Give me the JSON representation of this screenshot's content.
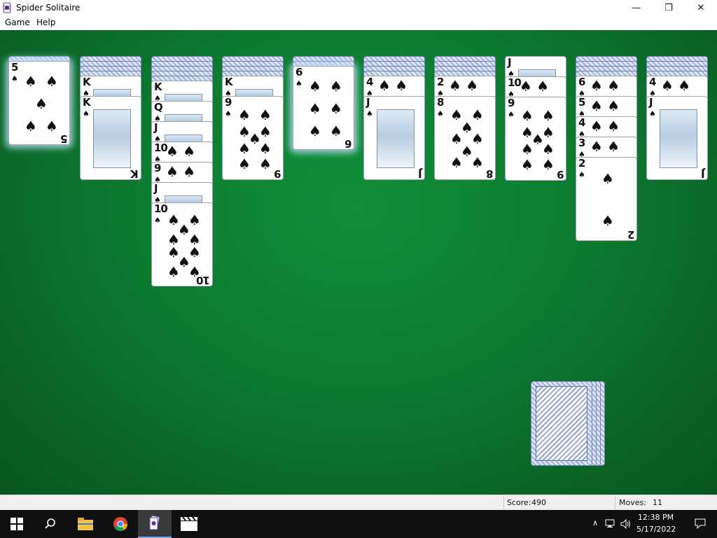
{
  "window": {
    "title": "Spider Solitaire",
    "icon": "spider-solitaire-icon",
    "controls": {
      "minimize": "—",
      "maximize": "❐",
      "close": "✕"
    }
  },
  "menu": [
    {
      "id": "game",
      "label": "Game"
    },
    {
      "id": "help",
      "label": "Help"
    }
  ],
  "table": {
    "felt_color": "#0d7a30",
    "suit": "spades",
    "tableau": [
      {
        "facedown": 1,
        "faceup": [
          "5"
        ],
        "highlighted": true
      },
      {
        "facedown": 4,
        "faceup": [
          "K",
          "K"
        ],
        "highlighted": false
      },
      {
        "facedown": 5,
        "faceup": [
          "K",
          "Q",
          "J",
          "10",
          "9",
          "J",
          "10"
        ],
        "highlighted": false
      },
      {
        "facedown": 4,
        "faceup": [
          "K",
          "9"
        ],
        "highlighted": false
      },
      {
        "facedown": 2,
        "faceup": [
          "6"
        ],
        "highlighted": true
      },
      {
        "facedown": 4,
        "faceup": [
          "4",
          "J"
        ],
        "highlighted": false
      },
      {
        "facedown": 4,
        "faceup": [
          "2",
          "8"
        ],
        "highlighted": false
      },
      {
        "facedown": 0,
        "faceup": [
          "J",
          "10",
          "9"
        ],
        "highlighted": false
      },
      {
        "facedown": 4,
        "faceup": [
          "6",
          "5",
          "4",
          "3",
          "2"
        ],
        "highlighted": false
      },
      {
        "facedown": 4,
        "faceup": [
          "4",
          "J"
        ],
        "highlighted": false
      }
    ],
    "stock_piles": 4
  },
  "status": {
    "score_label": "Score:",
    "score": "490",
    "moves_label": "Moves:",
    "moves": "11"
  },
  "taskbar": {
    "items": [
      "start-icon",
      "search-icon",
      "file-explorer-icon",
      "chrome-icon",
      "spider-solitaire-icon",
      "video-editor-icon"
    ],
    "tray": [
      "chevron-up-icon",
      "network-icon",
      "volume-icon"
    ],
    "time": "12:38 PM",
    "date": "5/17/2022",
    "notification_icon": "notification-icon"
  }
}
